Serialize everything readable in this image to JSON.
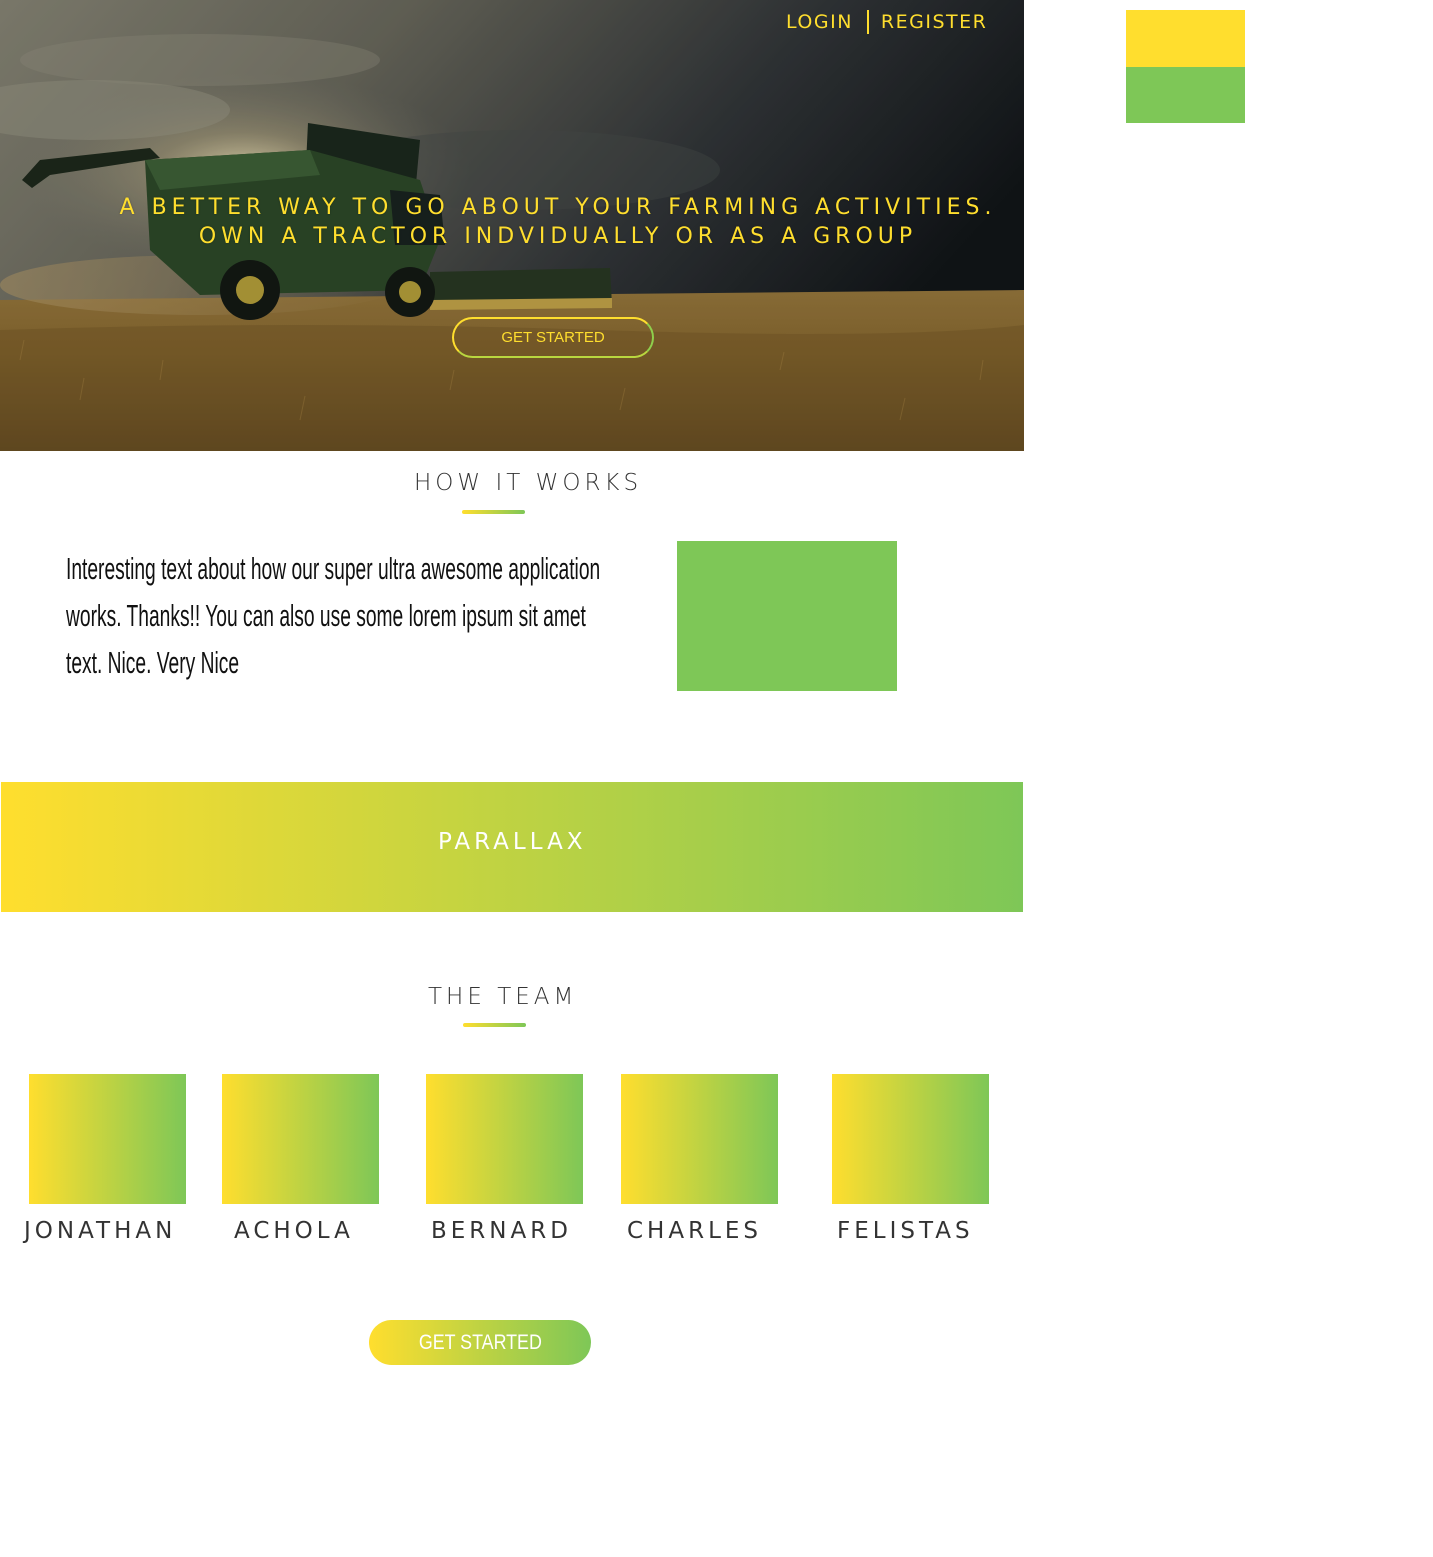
{
  "colors": {
    "accent_yellow": "#ffde2e",
    "accent_green": "#7ec757",
    "heading_text": "#333333",
    "body_text": "#111111"
  },
  "nav": {
    "login": "LOGIN",
    "register": "REGISTER"
  },
  "hero": {
    "headline_line1": "A BETTER WAY TO GO ABOUT YOUR FARMING ACTIVITIES.",
    "headline_line2": "OWN A TRACTOR INDVIDUALLY OR AS A GROUP",
    "cta_label": "GET STARTED"
  },
  "how_it_works": {
    "title": "HOW IT WORKS",
    "body": "Interesting text about how our super ultra awesome application works. Thanks!! You can also use some lorem ipsum sit amet text. Nice. Very Nice"
  },
  "parallax": {
    "label": "PARALLAX"
  },
  "team": {
    "title": "THE TEAM",
    "members": [
      {
        "name": "JONATHAN"
      },
      {
        "name": "ACHOLA"
      },
      {
        "name": "BERNARD"
      },
      {
        "name": "CHARLES"
      },
      {
        "name": "FELISTAS"
      }
    ]
  },
  "footer_cta": {
    "label": "GET STARTED"
  }
}
